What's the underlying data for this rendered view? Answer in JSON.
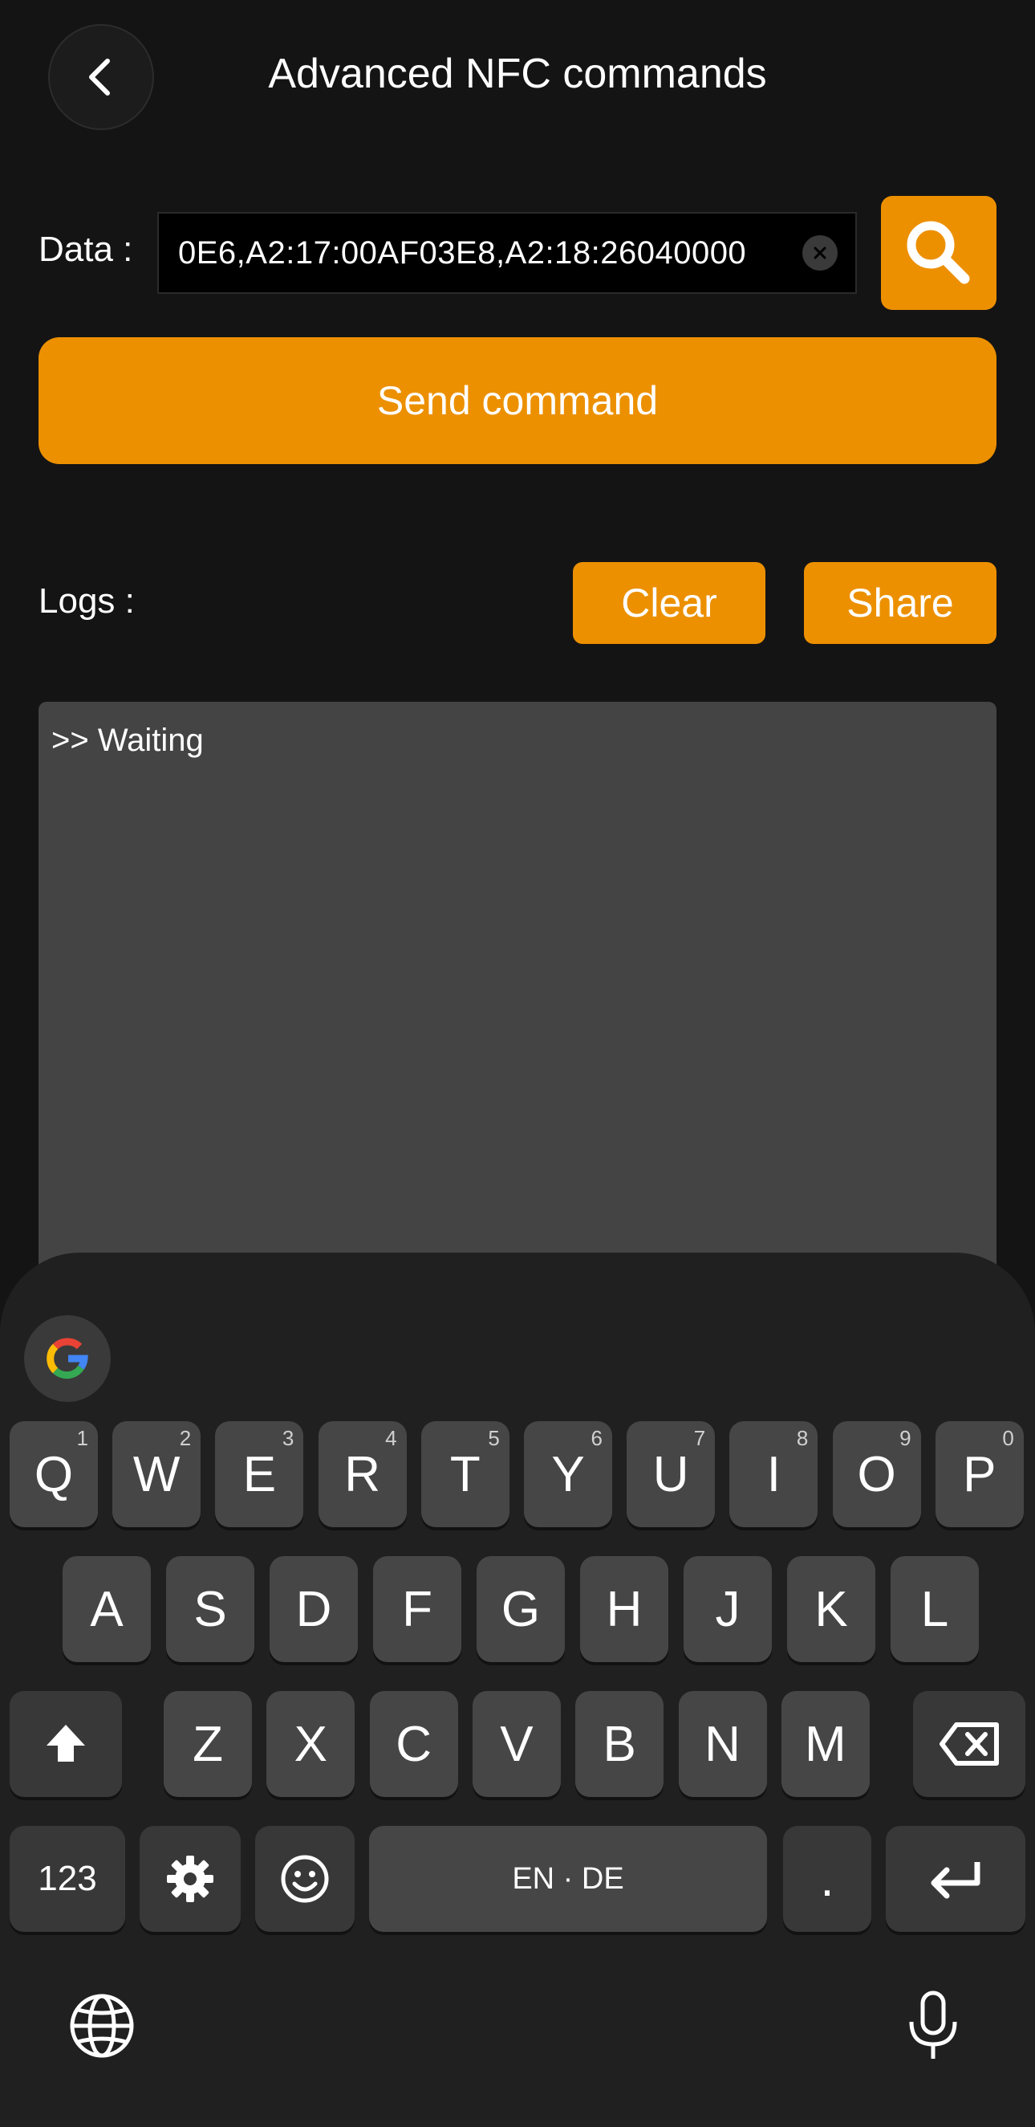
{
  "header": {
    "title": "Advanced NFC commands",
    "back_icon": "chevron-left-icon"
  },
  "data_row": {
    "label": "Data :",
    "value": "0E6,A2:17:00AF03E8,A2:18:26040000",
    "clear_icon": "clear-circle-icon",
    "search_icon": "search-icon"
  },
  "send_button": {
    "label": "Send command"
  },
  "logs": {
    "label": "Logs :",
    "clear_label": "Clear",
    "share_label": "Share",
    "content": ">> Waiting"
  },
  "keyboard": {
    "row1": [
      {
        "key": "Q",
        "hint": "1"
      },
      {
        "key": "W",
        "hint": "2"
      },
      {
        "key": "E",
        "hint": "3"
      },
      {
        "key": "R",
        "hint": "4"
      },
      {
        "key": "T",
        "hint": "5"
      },
      {
        "key": "Y",
        "hint": "6"
      },
      {
        "key": "U",
        "hint": "7"
      },
      {
        "key": "I",
        "hint": "8"
      },
      {
        "key": "O",
        "hint": "9"
      },
      {
        "key": "P",
        "hint": "0"
      }
    ],
    "row2": [
      "A",
      "S",
      "D",
      "F",
      "G",
      "H",
      "J",
      "K",
      "L"
    ],
    "row3": [
      "Z",
      "X",
      "C",
      "V",
      "B",
      "N",
      "M"
    ],
    "numbers_key": "123",
    "space_label": "EN · DE",
    "period_key": ".",
    "icons": {
      "google": "google-icon",
      "shift": "shift-icon",
      "backspace": "backspace-icon",
      "settings": "gear-icon",
      "emoji": "emoji-icon",
      "enter": "enter-icon",
      "globe": "globe-icon",
      "mic": "microphone-icon"
    }
  },
  "colors": {
    "accent": "#ec9000",
    "background": "#141414",
    "log_background": "#444444",
    "key": "#464646"
  }
}
